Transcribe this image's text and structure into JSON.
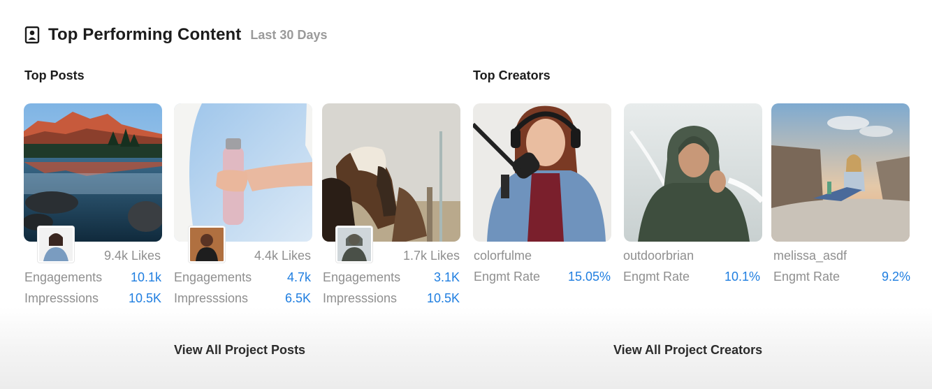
{
  "header": {
    "title": "Top Performing Content",
    "subtitle": "Last 30 Days",
    "icon": "contact-card-icon"
  },
  "sections": {
    "top_posts_label": "Top Posts",
    "top_creators_label": "Top Creators"
  },
  "posts": [
    {
      "image": "mountain-lake-photo",
      "likes": "9.4k Likes",
      "engagements_label": "Engagements",
      "engagements": "10.1k",
      "impressions_label": "Impresssions",
      "impressions": "10.5K"
    },
    {
      "image": "pink-water-bottle-photo",
      "likes": "4.4k Likes",
      "engagements_label": "Engagements",
      "engagements": "4.7k",
      "impressions_label": "Impresssions",
      "impressions": "6.5K"
    },
    {
      "image": "horses-photo",
      "likes": "1.7k Likes",
      "engagements_label": "Engagements",
      "engagements": "3.1K",
      "impressions_label": "Impresssions",
      "impressions": "10.5K"
    }
  ],
  "creators": [
    {
      "image": "podcaster-photo",
      "name": "colorfulme",
      "rate_label": "Engmt Rate",
      "rate": "15.05%"
    },
    {
      "image": "hooded-man-photo",
      "name": "outdoorbrian",
      "rate_label": "Engmt Rate",
      "rate": "10.1%"
    },
    {
      "image": "woman-on-cliff-photo",
      "name": "melissa_asdf",
      "rate_label": "Engmt Rate",
      "rate": "9.2%"
    }
  ],
  "footer": {
    "view_posts": "View All Project Posts",
    "view_creators": "View All Project Creators"
  },
  "colors": {
    "accent_value": "#1f7ee0",
    "muted_text": "#8f8f8f",
    "heading": "#1c1c1c"
  }
}
